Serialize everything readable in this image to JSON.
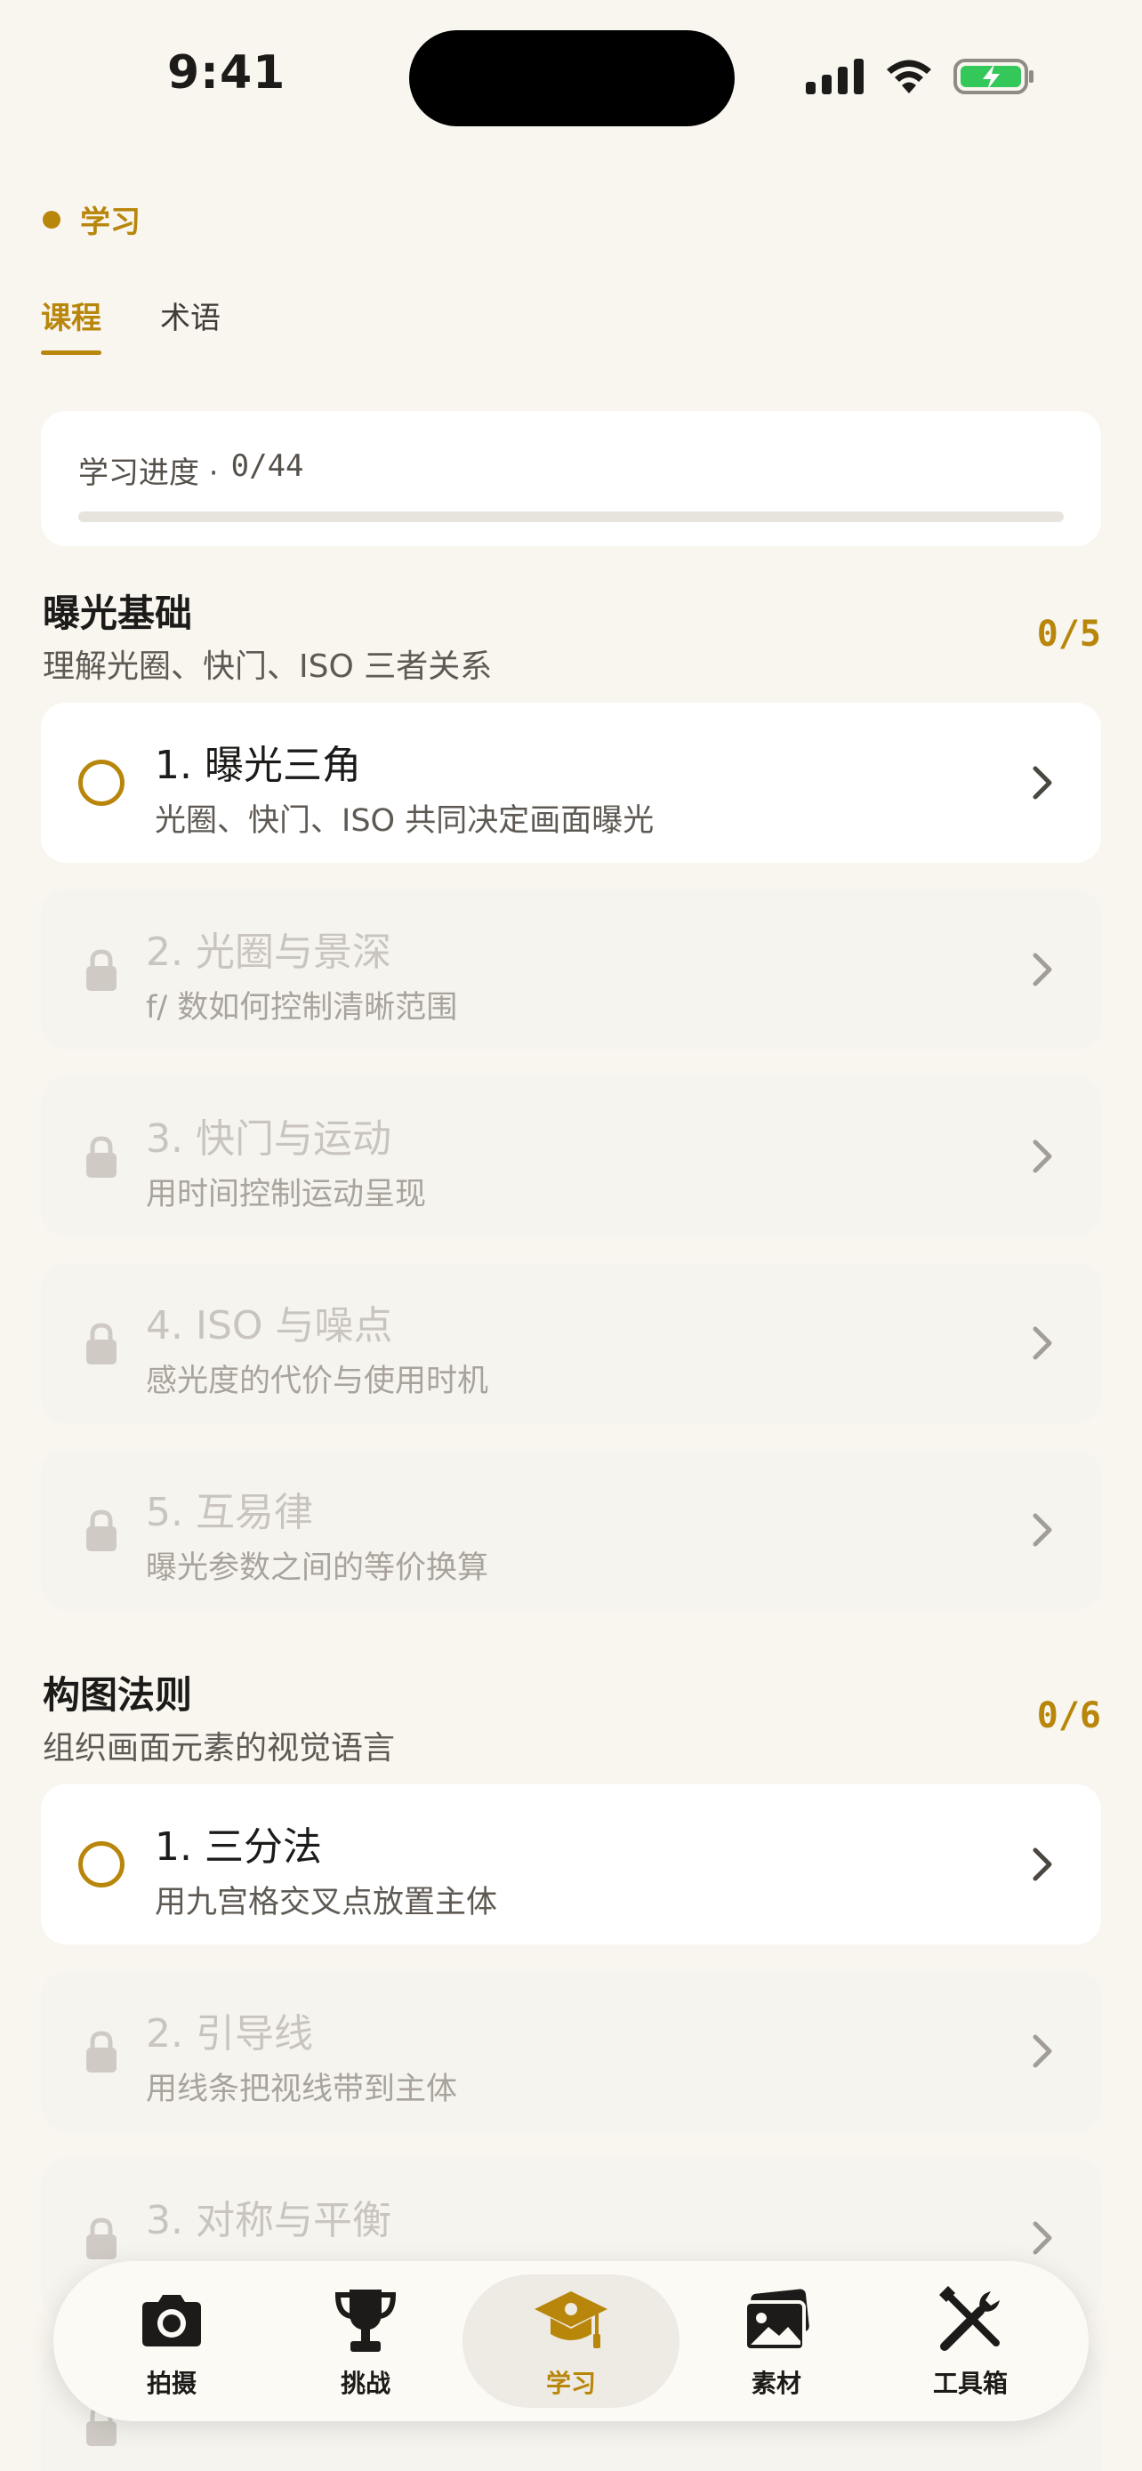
{
  "status_bar": {
    "time": "9:41"
  },
  "header": {
    "title": "学习"
  },
  "tabs": [
    {
      "label": "课程",
      "active": true
    },
    {
      "label": "术语",
      "active": false
    }
  ],
  "progress": {
    "label": "学习进度 ·",
    "count": "0/44",
    "fraction": 0
  },
  "sections": [
    {
      "name": "曝光基础",
      "description": "理解光圈、快门、ISO 三者关系",
      "count": "0/5",
      "lessons": [
        {
          "title": "1. 曝光三角",
          "subtitle": "光圈、快门、ISO 共同决定画面曝光",
          "locked": false
        },
        {
          "title": "2. 光圈与景深",
          "subtitle": "f/ 数如何控制清晰范围",
          "locked": true
        },
        {
          "title": "3. 快门与运动",
          "subtitle": "用时间控制运动呈现",
          "locked": true
        },
        {
          "title": "4. ISO 与噪点",
          "subtitle": "感光度的代价与使用时机",
          "locked": true
        },
        {
          "title": "5. 互易律",
          "subtitle": "曝光参数之间的等价换算",
          "locked": true
        }
      ]
    },
    {
      "name": "构图法则",
      "description": "组织画面元素的视觉语言",
      "count": "0/6",
      "lessons": [
        {
          "title": "1. 三分法",
          "subtitle": "用九宫格交叉点放置主体",
          "locked": false
        },
        {
          "title": "2. 引导线",
          "subtitle": "用线条把视线带到主体",
          "locked": true
        },
        {
          "title": "3. 对称与平衡",
          "subtitle": "",
          "locked": true
        },
        {
          "title": "",
          "subtitle": "",
          "locked": true
        }
      ]
    }
  ],
  "tabbar": [
    {
      "label": "拍摄",
      "icon": "camera-icon",
      "active": false
    },
    {
      "label": "挑战",
      "icon": "trophy-icon",
      "active": false
    },
    {
      "label": "学习",
      "icon": "graduation-cap-icon",
      "active": true
    },
    {
      "label": "素材",
      "icon": "photos-icon",
      "active": false
    },
    {
      "label": "工具箱",
      "icon": "tools-icon",
      "active": false
    }
  ],
  "colors": {
    "accent": "#b8860b",
    "background": "#f9f6f0",
    "battery": "#34c759"
  }
}
